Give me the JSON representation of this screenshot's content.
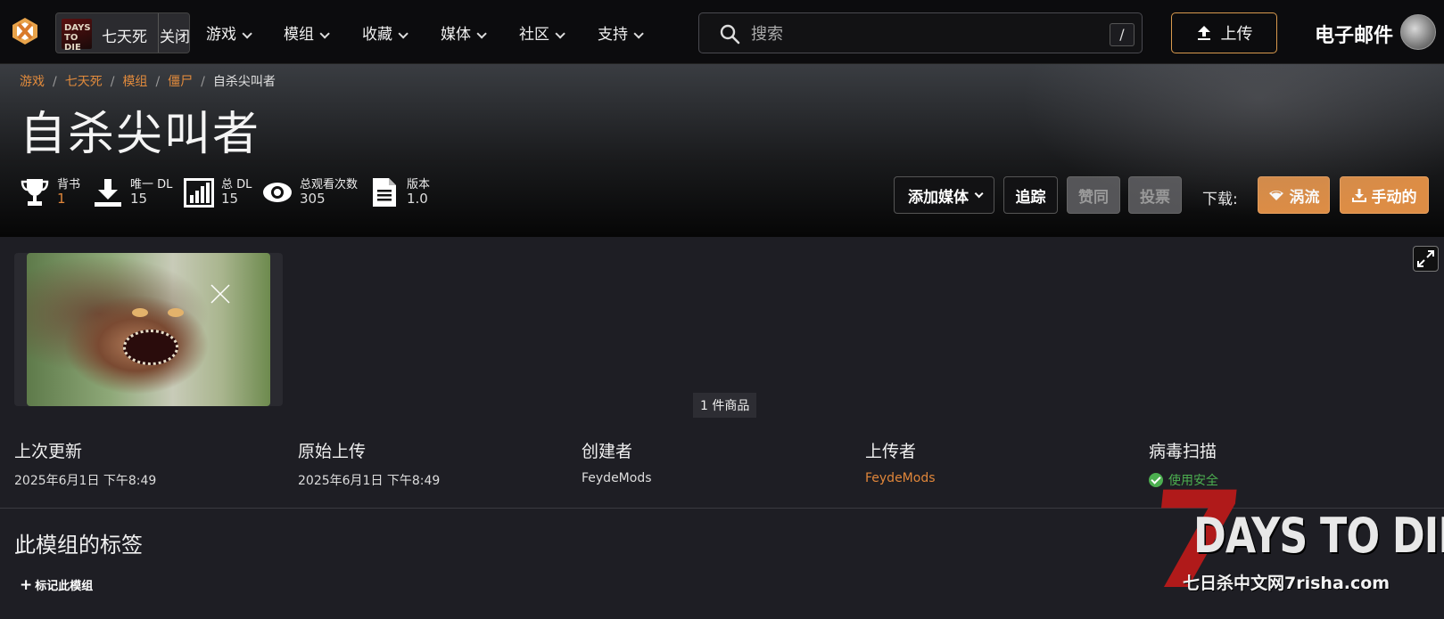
{
  "nav": {
    "game_thumb_text": "DAYS TO DIE",
    "game_name": "七天死",
    "close_label": "关闭",
    "items": [
      {
        "label": "游戏"
      },
      {
        "label": "模组"
      },
      {
        "label": "收藏"
      },
      {
        "label": "媒体"
      },
      {
        "label": "社区"
      },
      {
        "label": "支持"
      }
    ],
    "search_placeholder": "搜索",
    "search_shortcut": "/",
    "upload_label": "上传",
    "email_label": "电子邮件"
  },
  "breadcrumb": {
    "items": [
      "游戏",
      "七天死",
      "模组",
      "僵尸"
    ],
    "current": "自杀尖叫者"
  },
  "page_title": "自杀尖叫者",
  "stats": [
    {
      "icon": "trophy-icon",
      "label": "背书",
      "value": "1",
      "accent": true
    },
    {
      "icon": "download-icon",
      "label": "唯一 DL",
      "value": "15",
      "accent": false
    },
    {
      "icon": "bar-chart-icon",
      "label": "总 DL",
      "value": "15",
      "accent": false
    },
    {
      "icon": "eye-icon",
      "label": "总观看次数",
      "value": "305",
      "accent": false
    },
    {
      "icon": "document-icon",
      "label": "版本",
      "value": "1.0",
      "accent": false
    }
  ],
  "actions": {
    "add_media": "添加媒体",
    "track": "追踪",
    "endorse": "赞同",
    "vote": "投票",
    "download_label": "下载:",
    "vortex": "涡流",
    "manual": "手动的"
  },
  "media": {
    "count_label": "1 件商品"
  },
  "info": [
    {
      "head": "上次更新",
      "value": "2025年6月1日 下午8:49",
      "style": "plain"
    },
    {
      "head": "原始上传",
      "value": "2025年6月1日 下午8:49",
      "style": "plain"
    },
    {
      "head": "创建者",
      "value": "FeydeMods",
      "style": "plain"
    },
    {
      "head": "上传者",
      "value": "FeydeMods",
      "style": "link"
    },
    {
      "head": "病毒扫描",
      "value": "使用安全",
      "style": "ok"
    }
  ],
  "tags": {
    "title": "此模组的标签",
    "tag_button": "标记此模组"
  },
  "watermark": {
    "seven": "7",
    "title": "DAYS TO DIE",
    "sub": "七日杀中文网7risha.com"
  },
  "colors": {
    "accent": "#e0863a",
    "button_orange": "#dd8d45",
    "ok_green": "#4caf50"
  }
}
